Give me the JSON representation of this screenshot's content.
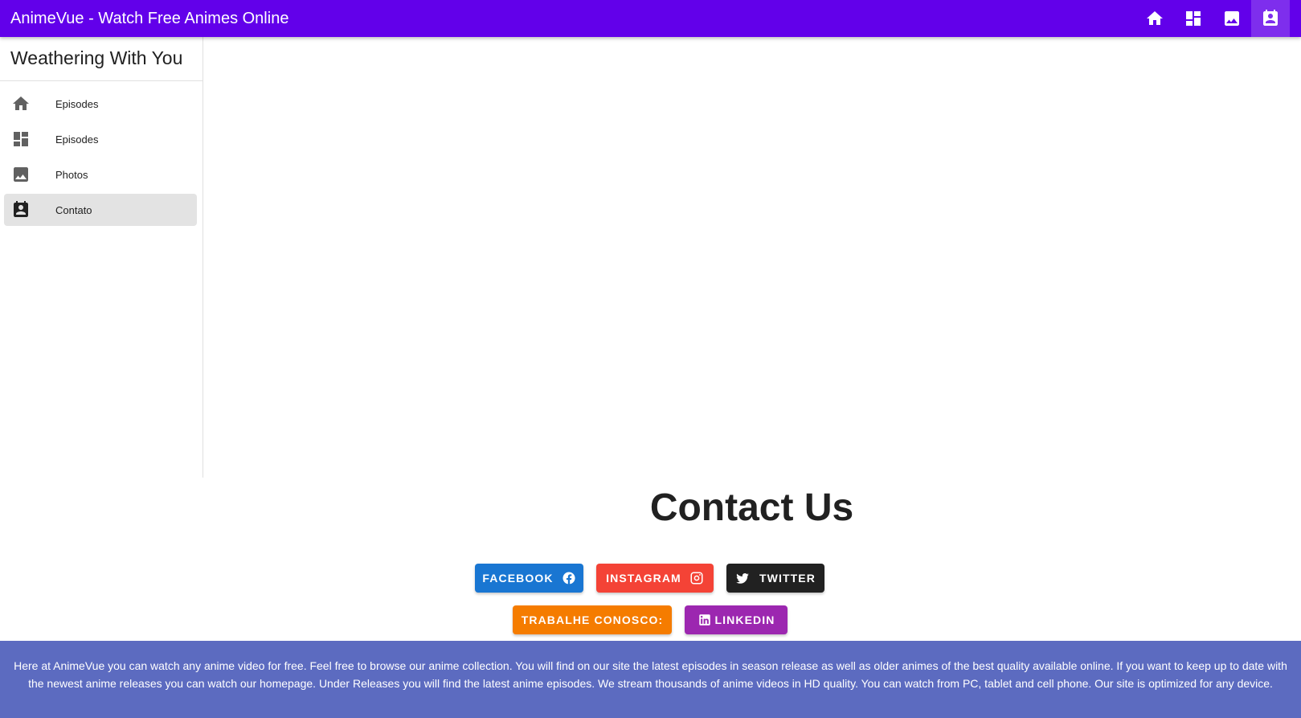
{
  "appbar": {
    "title": "AnimeVue - Watch Free Animes Online",
    "actions": [
      {
        "icon": "home-icon"
      },
      {
        "icon": "dashboard-icon"
      },
      {
        "icon": "image-icon"
      },
      {
        "icon": "contact-calendar-icon",
        "active": true
      }
    ]
  },
  "drawer": {
    "title": "Weathering With You",
    "items": [
      {
        "label": "Episodes",
        "icon": "home-icon"
      },
      {
        "label": "Episodes",
        "icon": "dashboard-icon"
      },
      {
        "label": "Photos",
        "icon": "image-icon"
      },
      {
        "label": "Contato",
        "icon": "contact-calendar-icon",
        "active": true
      }
    ]
  },
  "contact": {
    "title": "Contact Us",
    "buttons": {
      "facebook": "FACEBOOK",
      "instagram": "INSTAGRAM",
      "twitter": "TWITTER",
      "trabalhe": "TRABALHE CONOSCO:",
      "linkedin": "LINKEDIN"
    }
  },
  "colors": {
    "appbar": "#6200ea",
    "footer": "#5c6bc0",
    "facebook": "#1976d2",
    "instagram": "#f44336",
    "twitter": "#212121",
    "trabalhe": "#f57c00",
    "linkedin": "#9c27b0"
  },
  "footer": {
    "text": "Here at AnimeVue you can watch any anime video for free. Feel free to browse our anime collection. You will find on our site the latest episodes in season release as well as older animes of the best quality available online. If you want to keep up to date with the newest anime releases you can watch our homepage. Under Releases you will find the latest anime episodes. We stream thousands of anime videos in HD quality. You can watch from PC, tablet and cell phone. Our site is optimized for any device."
  }
}
